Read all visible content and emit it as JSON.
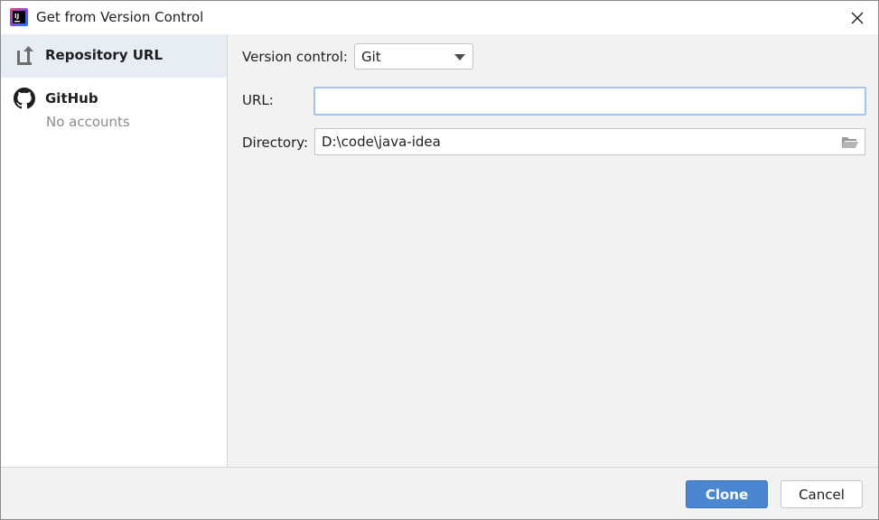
{
  "window": {
    "title": "Get from Version Control",
    "app_icon": "intellij-idea-icon",
    "close_icon": "close-icon"
  },
  "sidebar": {
    "items": [
      {
        "label": "Repository URL",
        "icon": "repository-url-icon",
        "selected": true
      },
      {
        "label": "GitHub",
        "sublabel": "No accounts",
        "icon": "github-icon",
        "selected": false
      }
    ]
  },
  "form": {
    "version_control_label": "Version control:",
    "version_control_value": "Git",
    "url_label": "URL:",
    "url_value": "",
    "directory_label": "Directory:",
    "directory_value": "D:\\code\\java-idea"
  },
  "footer": {
    "clone_label": "Clone",
    "cancel_label": "Cancel"
  },
  "colors": {
    "accent": "#4b86d0",
    "selection": "#e8ecf3",
    "focus_border": "#a7c4e8"
  }
}
